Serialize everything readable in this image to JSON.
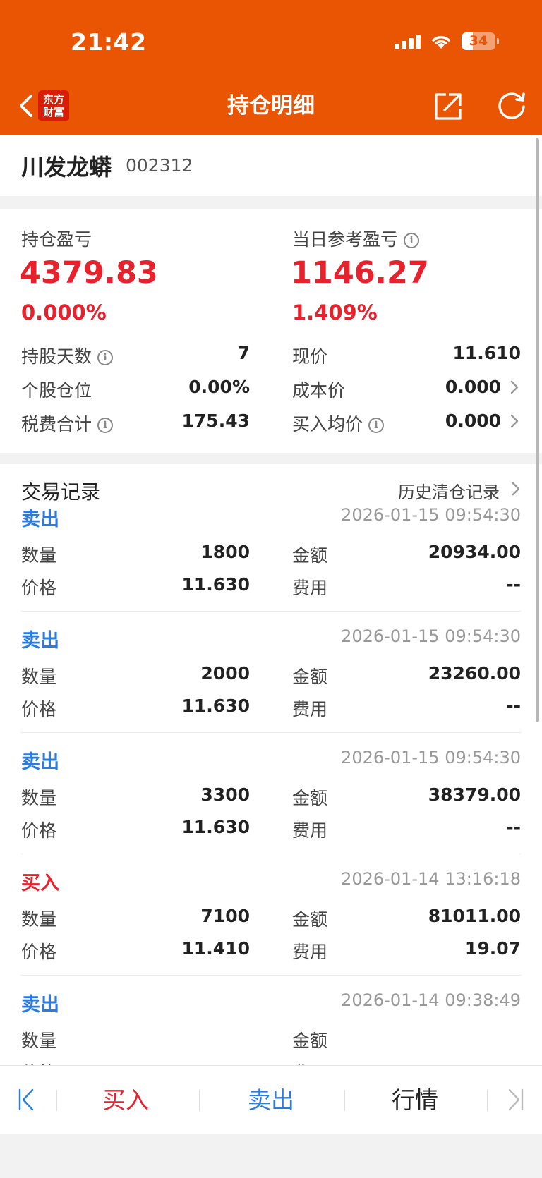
{
  "status": {
    "time": "21:42",
    "battery": "34"
  },
  "header": {
    "title": "持仓明细",
    "logo_line1": "东方",
    "logo_line2": "财富"
  },
  "stock": {
    "name": "川发龙蟒",
    "code": "002312"
  },
  "summary": {
    "pnl_label": "持仓盈亏",
    "pnl_value": "4379.83",
    "pnl_pct": "0.000%",
    "daily_label": "当日参考盈亏",
    "daily_value": "1146.27",
    "daily_pct": "1.409%",
    "rows": [
      {
        "l_label": "持股天数",
        "l_value": "7",
        "r_label": "现价",
        "r_value": "11.610"
      },
      {
        "l_label": "个股仓位",
        "l_value": "0.00%",
        "r_label": "成本价",
        "r_value": "0.000"
      },
      {
        "l_label": "税费合计",
        "l_value": "175.43",
        "r_label": "买入均价",
        "r_value": "0.000"
      }
    ]
  },
  "trades": {
    "title": "交易记录",
    "history_link": "历史清仓记录",
    "labels": {
      "qty": "数量",
      "amount": "金额",
      "price": "价格",
      "fee": "费用"
    },
    "items": [
      {
        "type": "卖出",
        "time": "2026-01-15 09:54:30",
        "qty": "1800",
        "amount": "20934.00",
        "price": "11.630",
        "fee": "--"
      },
      {
        "type": "卖出",
        "time": "2026-01-15 09:54:30",
        "qty": "2000",
        "amount": "23260.00",
        "price": "11.630",
        "fee": "--"
      },
      {
        "type": "卖出",
        "time": "2026-01-15 09:54:30",
        "qty": "3300",
        "amount": "38379.00",
        "price": "11.630",
        "fee": "--"
      },
      {
        "type": "买入",
        "time": "2026-01-14 13:16:18",
        "qty": "7100",
        "amount": "81011.00",
        "price": "11.410",
        "fee": "19.07"
      },
      {
        "type": "卖出",
        "time": "2026-01-14 09:38:49",
        "qty": "",
        "amount": "",
        "price": "",
        "fee": ""
      }
    ]
  },
  "bottom_bar": {
    "buy": "买入",
    "sell": "卖出",
    "market": "行情"
  },
  "colors": {
    "header": "#ea5504",
    "up": "#e8222d",
    "sell": "#2a7ce3"
  }
}
